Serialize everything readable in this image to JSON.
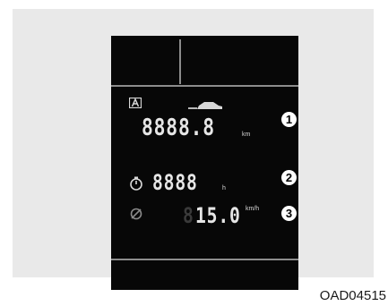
{
  "odometer": {
    "digits": "8888.8",
    "unit": "km",
    "callout": "1"
  },
  "drive_time": {
    "digits": "8888",
    "unit": "h",
    "callout": "2"
  },
  "fuel_economy": {
    "ghost_digit": "8",
    "digits": "15.0",
    "unit": "km/h",
    "callout": "3"
  },
  "image_code": "OAD04515",
  "colors": {
    "lcd_background": "#070707",
    "panel_background": "#e9e9e9",
    "segment": "#e6e6e6"
  }
}
